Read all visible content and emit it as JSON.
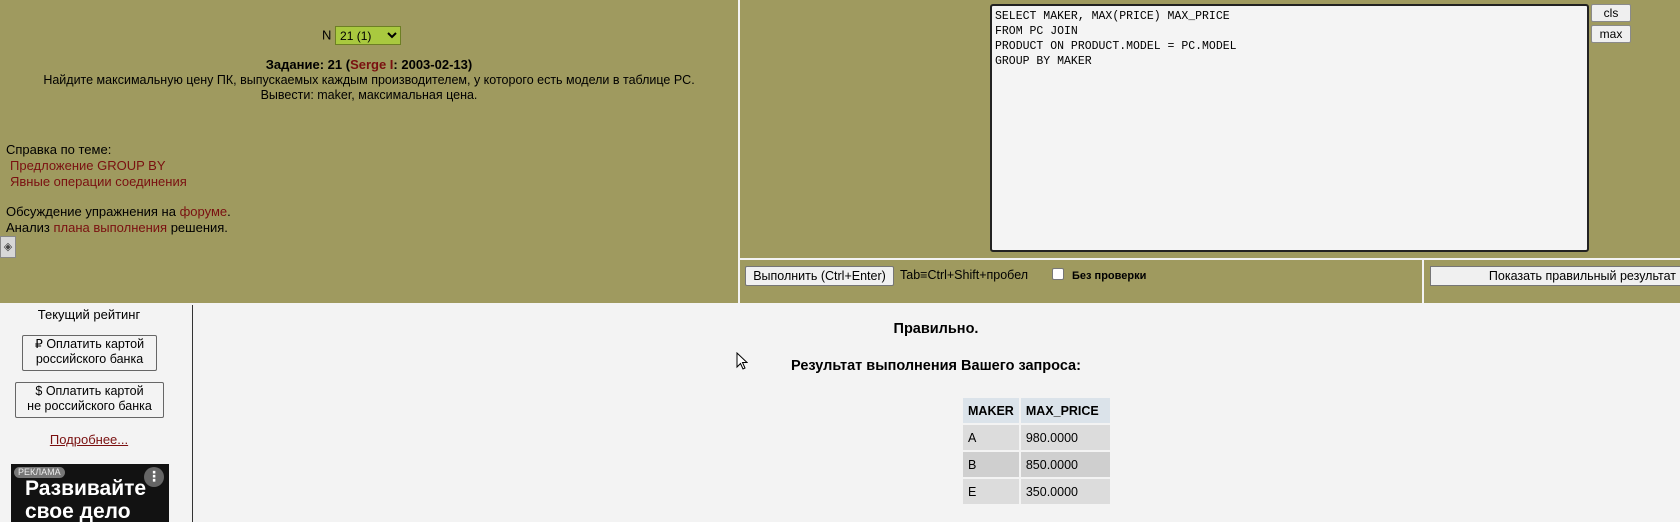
{
  "task": {
    "n_label": "N",
    "n_value": "21 (1)",
    "title_prefix": "Задание: 21 (",
    "author": "Serge I",
    "title_suffix": ": 2003-02-13)",
    "text_line1": "Найдите максимальную цену ПК, выпускаемых каждым производителем, у которого есть модели в таблице PC.",
    "text_line2": "Вывести: maker, максимальная цена."
  },
  "help": {
    "heading": "Справка по теме:",
    "link1": "Предложение GROUP BY",
    "link2": "Явные операции соединения",
    "forum_prefix": "Обсуждение упражнения на ",
    "forum_link": "форуме",
    "forum_suffix": ".",
    "plan_prefix": "Анализ ",
    "plan_link": "плана выполнения",
    "plan_suffix": " решения."
  },
  "editor": {
    "sql": "SELECT MAKER, MAX(PRICE) MAX_PRICE\nFROM PC JOIN\nPRODUCT ON PRODUCT.MODEL = PC.MODEL\nGROUP BY MAKER",
    "cls_label": "cls",
    "max_label": "max"
  },
  "run": {
    "run_label": "Выполнить (Ctrl+Enter)",
    "hint": "Tab≡Ctrl+Shift+пробел",
    "nocheck_label": "Без  проверки",
    "show_result_label": "Показать правильный результат"
  },
  "rating": {
    "title": "Текущий рейтинг",
    "pay_ru": "₽ Оплатить картой российского банка",
    "pay_ru_line1": "₽ Оплатить картой",
    "pay_ru_line2": "российского банка",
    "pay_foreign_line1": "$ Оплатить картой",
    "pay_foreign_line2": "не российского банка",
    "more": "Подробнее..."
  },
  "ad": {
    "tag": "РЕКЛАМА",
    "line1": "Развивайте",
    "line2": "свое дело"
  },
  "result": {
    "status": "Правильно.",
    "caption": "Результат выполнения Вашего запроса:",
    "columns": [
      "MAKER",
      "MAX_PRICE"
    ],
    "rows": [
      [
        "A",
        "980.0000"
      ],
      [
        "B",
        "850.0000"
      ],
      [
        "E",
        "350.0000"
      ]
    ]
  },
  "colors": {
    "olive": "#9f9a5f",
    "link": "#7a1010",
    "select": "#a9c93f"
  }
}
